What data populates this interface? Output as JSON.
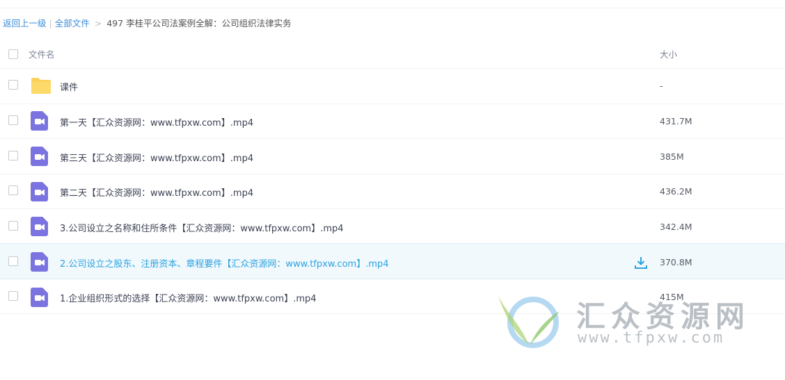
{
  "breadcrumb": {
    "back": "返回上一级",
    "separator": "|",
    "all_files": "全部文件",
    "arrow": ">",
    "current": "497 李桂平公司法案例全解：公司组织法律实务"
  },
  "table": {
    "col_name": "文件名",
    "col_size": "大小",
    "rows": [
      {
        "type": "folder",
        "name": "课件",
        "size": "-"
      },
      {
        "type": "video",
        "name": "第一天【汇众资源网：www.tfpxw.com】.mp4",
        "size": "431.7M"
      },
      {
        "type": "video",
        "name": "第三天【汇众资源网：www.tfpxw.com】.mp4",
        "size": "385M"
      },
      {
        "type": "video",
        "name": "第二天【汇众资源网：www.tfpxw.com】.mp4",
        "size": "436.2M"
      },
      {
        "type": "video",
        "name": "3.公司设立之名称和住所条件【汇众资源网：www.tfpxw.com】.mp4",
        "size": "342.4M"
      },
      {
        "type": "video",
        "name": "2.公司设立之股东、注册资本、章程要件【汇众资源网：www.tfpxw.com】.mp4",
        "size": "370.8M",
        "highlighted": true
      },
      {
        "type": "video",
        "name": "1.企业组织形式的选择【汇众资源网：www.tfpxw.com】.mp4",
        "size": "415M"
      }
    ]
  },
  "watermark": {
    "title": "汇众资源网",
    "url": "www.tfpxw.com"
  },
  "colors": {
    "link": "#3b8cd9",
    "highlight_text": "#2aa2e0",
    "video_icon": "#7a73e0",
    "folder_icon": "#fcd15b"
  },
  "icons": {
    "folder": "folder-icon",
    "video": "video-file-icon",
    "download": "download-icon"
  }
}
